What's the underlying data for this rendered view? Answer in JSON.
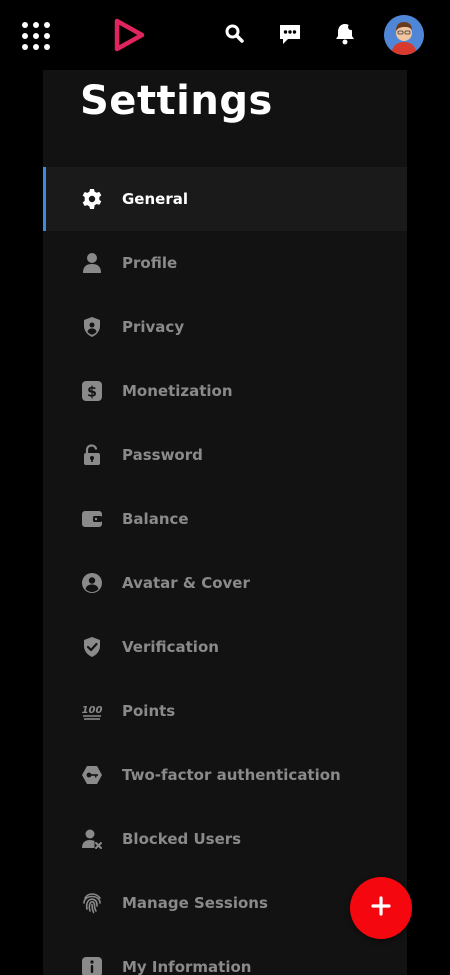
{
  "header": {
    "apps_icon": "grid-icon",
    "logo_icon": "play-logo-icon",
    "search_icon": "search-icon",
    "messages_icon": "chat-icon",
    "notifications_icon": "bell-icon",
    "avatar_icon": "user-avatar"
  },
  "page": {
    "title": "Settings"
  },
  "menu": {
    "active_index": 0,
    "accent_color": "#3d8be0",
    "items": [
      {
        "label": "General",
        "icon": "gear-icon"
      },
      {
        "label": "Profile",
        "icon": "person-icon"
      },
      {
        "label": "Privacy",
        "icon": "shield-user-icon"
      },
      {
        "label": "Monetization",
        "icon": "dollar-icon"
      },
      {
        "label": "Password",
        "icon": "unlock-icon"
      },
      {
        "label": "Balance",
        "icon": "wallet-icon"
      },
      {
        "label": "Avatar & Cover",
        "icon": "account-circle-icon"
      },
      {
        "label": "Verification",
        "icon": "shield-check-icon"
      },
      {
        "label": "Points",
        "icon": "hundred-icon"
      },
      {
        "label": "Two-factor authentication",
        "icon": "key-shield-icon"
      },
      {
        "label": "Blocked Users",
        "icon": "user-blocked-icon"
      },
      {
        "label": "Manage Sessions",
        "icon": "fingerprint-icon"
      },
      {
        "label": "My Information",
        "icon": "info-icon"
      }
    ]
  },
  "fab": {
    "icon": "plus-icon",
    "color": "#f5070f"
  }
}
